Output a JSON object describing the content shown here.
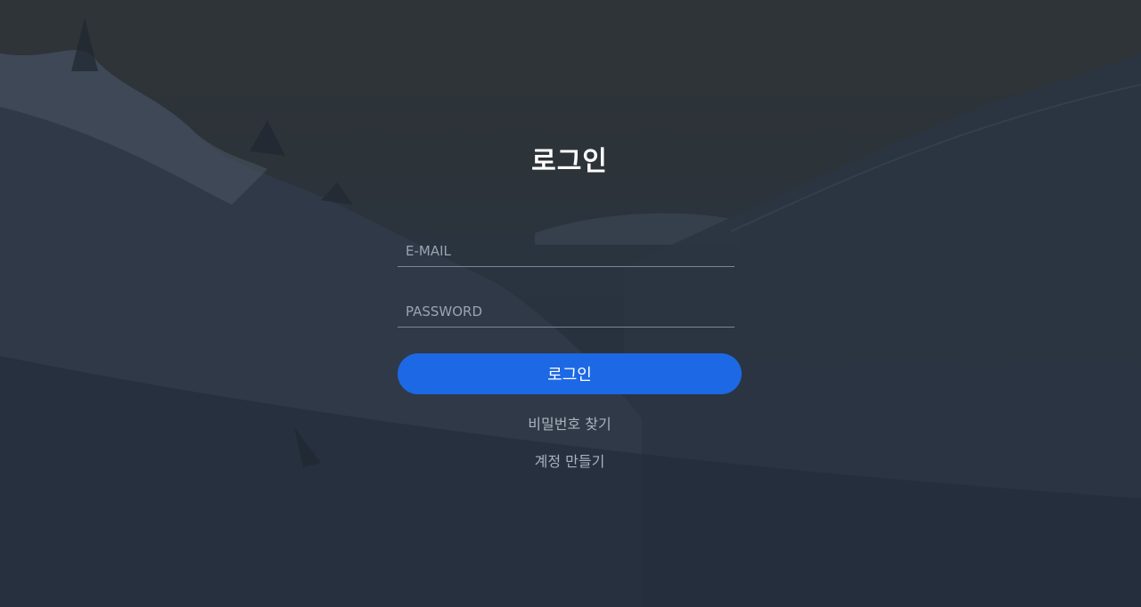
{
  "login": {
    "title": "로그인",
    "email_placeholder": "E-MAIL",
    "email_value": "",
    "password_placeholder": "PASSWORD",
    "password_value": "",
    "submit_label": "로그인",
    "forgot_password_label": "비밀번호 찾기",
    "create_account_label": "계정 만들기"
  },
  "colors": {
    "accent": "#1d68e4",
    "title_text": "#ffffff",
    "link_text": "#aab2bd",
    "field_underline": "#7b8696"
  }
}
